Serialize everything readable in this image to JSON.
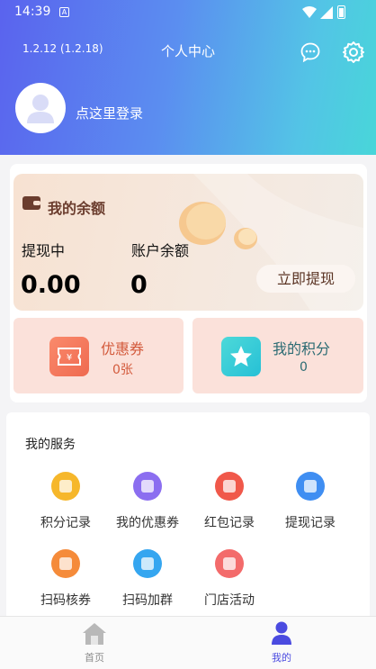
{
  "status_bar": {
    "time": "14:39",
    "notification_icon": "A"
  },
  "header": {
    "version": "1.2.12 (1.2.18)",
    "title": "个人中心",
    "message_icon": "chat-bubble-icon",
    "settings_icon": "gear-icon"
  },
  "profile": {
    "login_prompt": "点这里登录"
  },
  "wallet": {
    "title": "我的余额",
    "withdrawing_label": "提现中",
    "withdrawing_value": "0.00",
    "account_label": "账户余额",
    "account_value": "0",
    "withdraw_button": "立即提现"
  },
  "coupons": {
    "label": "优惠券",
    "value": "0张"
  },
  "points": {
    "label": "我的积分",
    "value": "0"
  },
  "services": {
    "title": "我的服务",
    "items": [
      {
        "label": "积分记录",
        "color": "#f6b72b"
      },
      {
        "label": "我的优惠券",
        "color": "#8b6ef0"
      },
      {
        "label": "红包记录",
        "color": "#f0584a"
      },
      {
        "label": "提现记录",
        "color": "#3f8ef2"
      },
      {
        "label": "扫码核券",
        "color": "#f58b3a"
      },
      {
        "label": "扫码加群",
        "color": "#35a6f0"
      },
      {
        "label": "门店活动",
        "color": "#f36b6b"
      }
    ]
  },
  "tabbar": {
    "items": [
      {
        "label": "首页",
        "active": false
      },
      {
        "label": "我的",
        "active": true
      }
    ]
  },
  "colors": {
    "accent": "#4b4be0",
    "inactive": "#8c8c8c"
  }
}
